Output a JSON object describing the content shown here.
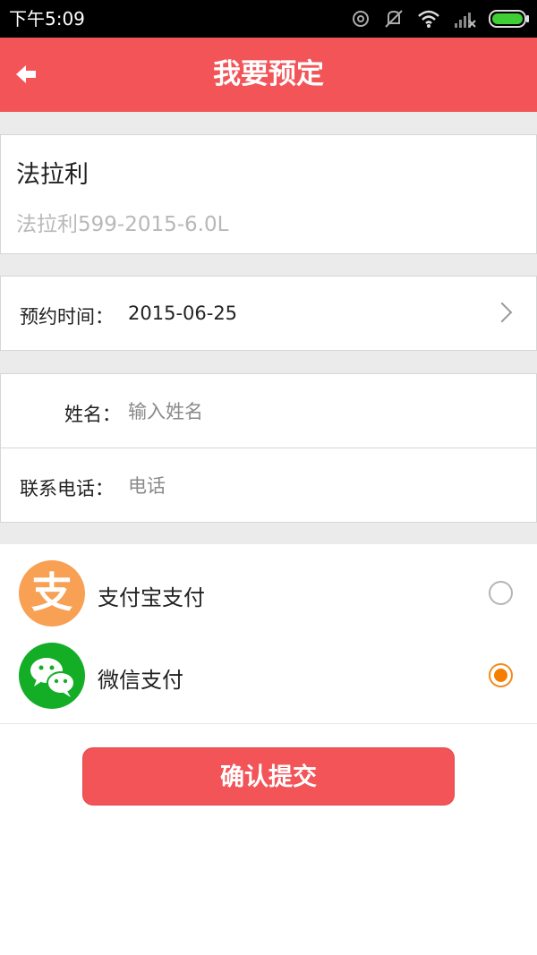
{
  "status_bar": {
    "time": "下午5:09"
  },
  "header": {
    "title": "我要预定"
  },
  "car": {
    "name": "法拉利",
    "model": "法拉利599-2015-6.0L"
  },
  "reservation": {
    "label": "预约时间：",
    "date": "2015-06-25"
  },
  "form": {
    "name_label": "姓名：",
    "name_placeholder": "输入姓名",
    "phone_label": "联系电话：",
    "phone_placeholder": "电话"
  },
  "payment": {
    "options": [
      {
        "label": "支付宝支付",
        "icon": "alipay-icon",
        "icon_glyph": "支",
        "selected": false,
        "color": "#f8a053"
      },
      {
        "label": "微信支付",
        "icon": "wechat-icon",
        "selected": true,
        "color": "#13ad26"
      }
    ]
  },
  "submit": {
    "label": "确认提交"
  },
  "colors": {
    "accent": "#f25458",
    "radio_selected": "#f57d00"
  }
}
